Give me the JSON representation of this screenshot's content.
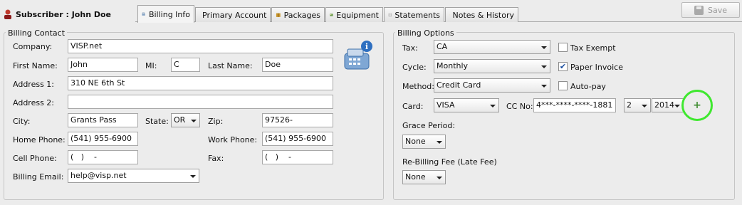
{
  "header": {
    "subscriber_label": "Subscriber : John Doe",
    "save_label": "Save",
    "tabs": [
      {
        "label": "Billing Info",
        "icon": "billing-info-icon",
        "active": true
      },
      {
        "label": "Primary Account",
        "icon": "primary-account-icon",
        "active": false
      },
      {
        "label": "Packages",
        "icon": "packages-icon",
        "active": false
      },
      {
        "label": "Equipment",
        "icon": "equipment-icon",
        "active": false
      },
      {
        "label": "Statements",
        "icon": "statements-icon",
        "active": false
      },
      {
        "label": "Notes & History",
        "icon": "notes-icon",
        "active": false
      }
    ]
  },
  "billing_contact": {
    "title": "Billing Contact",
    "company_label": "Company:",
    "company": "VISP.net",
    "first_name_label": "First Name:",
    "first_name": "John",
    "mi_label": "MI:",
    "mi": "C",
    "last_name_label": "Last Name:",
    "last_name": "Doe",
    "address1_label": "Address 1:",
    "address1": "310 NE 6th St",
    "address2_label": "Address 2:",
    "address2": "",
    "city_label": "City:",
    "city": "Grants Pass",
    "state_label": "State:",
    "state": "OR",
    "zip_label": "Zip:",
    "zip": "97526-",
    "home_phone_label": "Home Phone:",
    "home_phone": "(541) 955-6900",
    "work_phone_label": "Work Phone:",
    "work_phone": "(541) 955-6900",
    "cell_phone_label": "Cell Phone:",
    "cell_phone": "(   )    -",
    "fax_label": "Fax:",
    "fax": "(   )    -",
    "email_label": "Billing Email:",
    "email": "help@visp.net"
  },
  "billing_options": {
    "title": "Billing Options",
    "tax_label": "Tax:",
    "tax": "CA",
    "tax_exempt_label": "Tax Exempt",
    "tax_exempt": false,
    "cycle_label": "Cycle:",
    "cycle": "Monthly",
    "paper_invoice_label": "Paper Invoice",
    "paper_invoice": true,
    "method_label": "Method:",
    "method": "Credit Card",
    "autopay_label": "Auto-pay",
    "autopay": false,
    "card_label": "Card:",
    "card": "VISA",
    "cc_no_label": "CC No:",
    "cc_no": "4***-****-****-1881",
    "exp_month": "2",
    "exp_year": "2014",
    "grace_label": "Grace Period:",
    "grace": "None",
    "rebill_label": "Re-Billing Fee (Late Fee)",
    "rebill": "None"
  },
  "colors": {
    "highlight_ring": "#3fe82f",
    "plus": "#3d8b2e"
  }
}
